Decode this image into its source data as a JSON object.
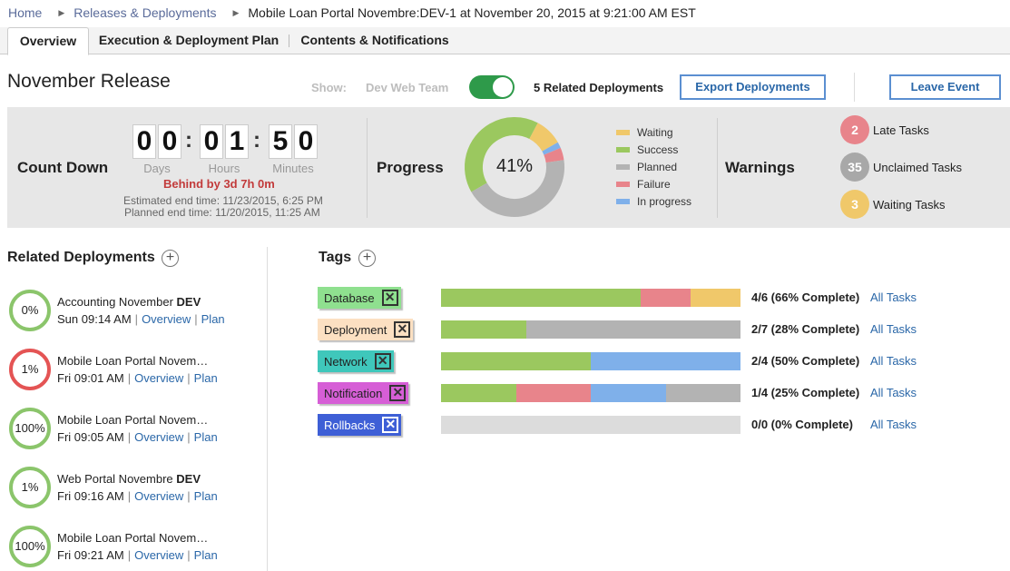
{
  "breadcrumb": {
    "home": "Home",
    "releases": "Releases & Deployments",
    "current": "Mobile Loan Portal Novembre:DEV-1 at November 20, 2015 at 9:21:00 AM EST"
  },
  "tabs": [
    "Overview",
    "Execution & Deployment Plan",
    "Contents & Notifications"
  ],
  "header": {
    "title": "November Release",
    "show_label": "Show:",
    "show_team": "Dev Web Team",
    "toggle_on": true,
    "related_count": "5 Related Deployments",
    "export_button": "Export Deployments",
    "leave_button": "Leave Event"
  },
  "countdown": {
    "title": "Count Down",
    "days": [
      "0",
      "0"
    ],
    "hours": [
      "0",
      "1"
    ],
    "minutes": [
      "5",
      "0"
    ],
    "days_label": "Days",
    "hours_label": "Hours",
    "minutes_label": "Minutes",
    "behind": "Behind by 3d 7h 0m",
    "estimated_end": "Estimated end time: 11/23/2015, 6:25 PM",
    "planned_end": "Planned end time: 11/20/2015, 11:25 AM"
  },
  "progress": {
    "title": "Progress",
    "percent_label": "41%",
    "segments": [
      {
        "name": "Success",
        "value": 41,
        "color": "#9bc85f"
      },
      {
        "name": "Waiting",
        "value": 9,
        "color": "#f0c86a"
      },
      {
        "name": "In progress",
        "value": 2,
        "color": "#7fb0ea"
      },
      {
        "name": "Failure",
        "value": 4,
        "color": "#e8848b"
      },
      {
        "name": "Planned",
        "value": 44,
        "color": "#b3b3b3"
      }
    ],
    "legend": [
      {
        "label": "Waiting",
        "color": "#f0c86a"
      },
      {
        "label": "Success",
        "color": "#9bc85f"
      },
      {
        "label": "Planned",
        "color": "#b3b3b3"
      },
      {
        "label": "Failure",
        "color": "#e8848b"
      },
      {
        "label": "In progress",
        "color": "#7fb0ea"
      }
    ]
  },
  "warnings": {
    "title": "Warnings",
    "items": [
      {
        "count": "2",
        "label": "Late Tasks",
        "color": "#e8848b"
      },
      {
        "count": "35",
        "label": "Unclaimed Tasks",
        "color": "#a8a8a8"
      },
      {
        "count": "3",
        "label": "Waiting Tasks",
        "color": "#f0c86a"
      }
    ]
  },
  "related": {
    "title": "Related Deployments",
    "overview_link": "Overview",
    "plan_link": "Plan",
    "items": [
      {
        "percent": "0%",
        "name": "Accounting November ",
        "env": "DEV",
        "time": "Sun 09:14 AM",
        "status": "green"
      },
      {
        "percent": "1%",
        "name": "Mobile Loan Portal Novem…",
        "env": "",
        "time": "Fri 09:01 AM",
        "status": "red"
      },
      {
        "percent": "100%",
        "name": "Mobile Loan Portal Novem…",
        "env": "",
        "time": "Fri 09:05 AM",
        "status": "green"
      },
      {
        "percent": "1%",
        "name": "Web Portal Novembre ",
        "env": "DEV",
        "time": "Fri 09:16 AM",
        "status": "green"
      },
      {
        "percent": "100%",
        "name": "Mobile Loan Portal Novem…",
        "env": "",
        "time": "Fri 09:21 AM",
        "status": "green"
      }
    ]
  },
  "tags": {
    "title": "Tags",
    "all_tasks_label": "All Tasks",
    "items": [
      {
        "name": "Database",
        "color": "#8fe08f",
        "complete": "4/6 (66% Complete)",
        "segments": [
          {
            "value": 66.7,
            "color": "#9bc85f"
          },
          {
            "value": 16.7,
            "color": "#e8848b"
          },
          {
            "value": 16.6,
            "color": "#f0c86a"
          }
        ]
      },
      {
        "name": "Deployment",
        "color": "#fce0c2",
        "complete": "2/7 (28% Complete)",
        "segments": [
          {
            "value": 28.6,
            "color": "#9bc85f"
          },
          {
            "value": 71.4,
            "color": "#b3b3b3"
          }
        ]
      },
      {
        "name": "Network",
        "color": "#3fc7bb",
        "complete": "2/4 (50% Complete)",
        "segments": [
          {
            "value": 50,
            "color": "#9bc85f"
          },
          {
            "value": 50,
            "color": "#7fb0ea"
          }
        ]
      },
      {
        "name": "Notification",
        "color": "#d65ed6",
        "complete": "1/4 (25% Complete)",
        "segments": [
          {
            "value": 25,
            "color": "#9bc85f"
          },
          {
            "value": 25,
            "color": "#e8848b"
          },
          {
            "value": 25,
            "color": "#7fb0ea"
          },
          {
            "value": 25,
            "color": "#b3b3b3"
          }
        ]
      },
      {
        "name": "Rollbacks",
        "color": "#3e5fd6",
        "complete": "0/0 (0% Complete)",
        "segments": []
      }
    ]
  }
}
